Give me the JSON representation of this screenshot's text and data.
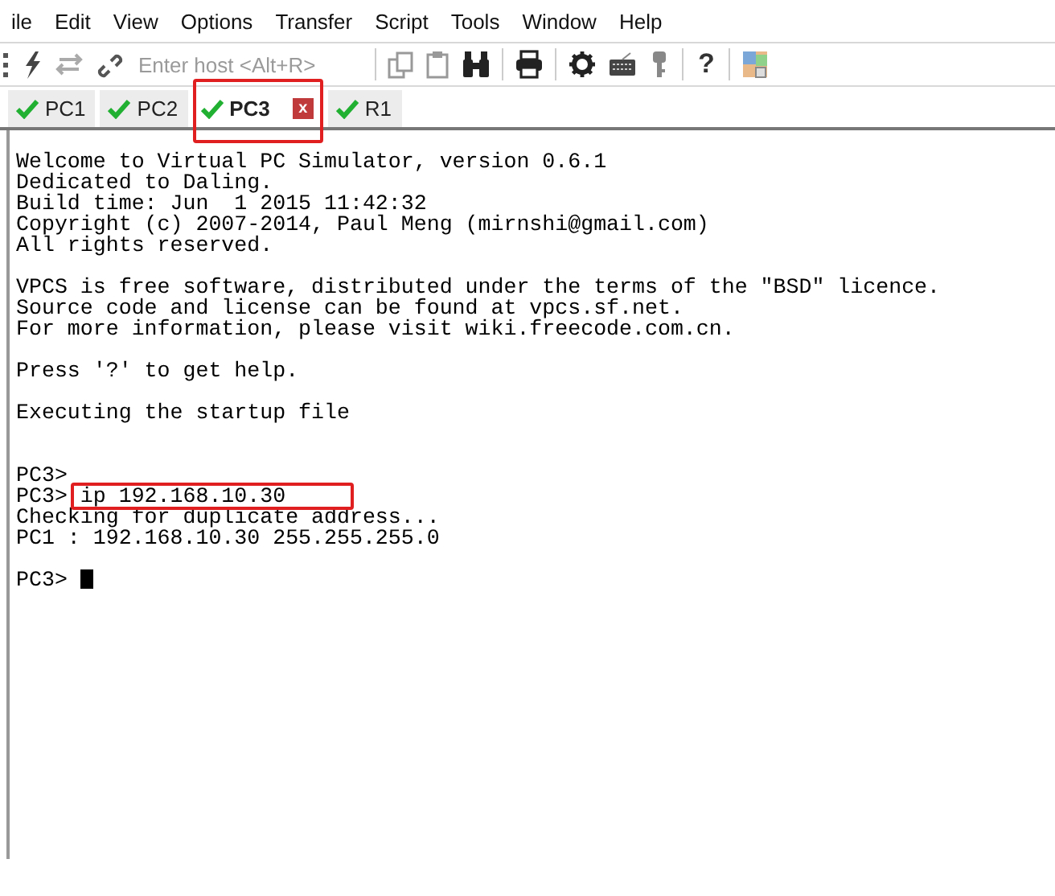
{
  "menu": [
    "ile",
    "Edit",
    "View",
    "Options",
    "Transfer",
    "Script",
    "Tools",
    "Window",
    "Help"
  ],
  "toolbar": {
    "host_field": {
      "placeholder": "Enter host <Alt+R>"
    },
    "help_button": "?"
  },
  "tabs": [
    {
      "label": "PC1",
      "selected": false,
      "connected": true,
      "highlighted": false
    },
    {
      "label": "PC2",
      "selected": false,
      "connected": true,
      "highlighted": false
    },
    {
      "label": "PC3",
      "selected": true,
      "connected": true,
      "highlighted": true,
      "close_label": "x"
    },
    {
      "label": "R1",
      "selected": false,
      "connected": true,
      "highlighted": false
    }
  ],
  "terminal": {
    "lines": [
      {
        "kind": "text",
        "text": "Welcome to Virtual PC Simulator, version 0.6.1"
      },
      {
        "kind": "text",
        "text": "Dedicated to Daling."
      },
      {
        "kind": "text",
        "text": "Build time: Jun  1 2015 11:42:32"
      },
      {
        "kind": "text",
        "text": "Copyright (c) 2007-2014, Paul Meng (mirnshi@gmail.com)"
      },
      {
        "kind": "text",
        "text": "All rights reserved."
      },
      {
        "kind": "blank"
      },
      {
        "kind": "text",
        "text": "VPCS is free software, distributed under the terms of the \"BSD\" licence."
      },
      {
        "kind": "text",
        "text": "Source code and license can be found at vpcs.sf.net."
      },
      {
        "kind": "text",
        "text": "For more information, please visit wiki.freecode.com.cn."
      },
      {
        "kind": "blank"
      },
      {
        "kind": "text",
        "text": "Press '?' to get help."
      },
      {
        "kind": "blank"
      },
      {
        "kind": "text",
        "text": "Executing the startup file"
      },
      {
        "kind": "blank"
      },
      {
        "kind": "blank"
      },
      {
        "kind": "prompt",
        "prompt": "PC3>"
      },
      {
        "kind": "prompt",
        "prompt": "PC3>",
        "command": "ip 192.168.10.30",
        "highlighted": true
      },
      {
        "kind": "text",
        "text": "Checking for duplicate address..."
      },
      {
        "kind": "text",
        "text": "PC1 : 192.168.10.30 255.255.255.0"
      },
      {
        "kind": "blank"
      },
      {
        "kind": "prompt",
        "prompt": "PC3>",
        "cursor": true
      }
    ]
  }
}
